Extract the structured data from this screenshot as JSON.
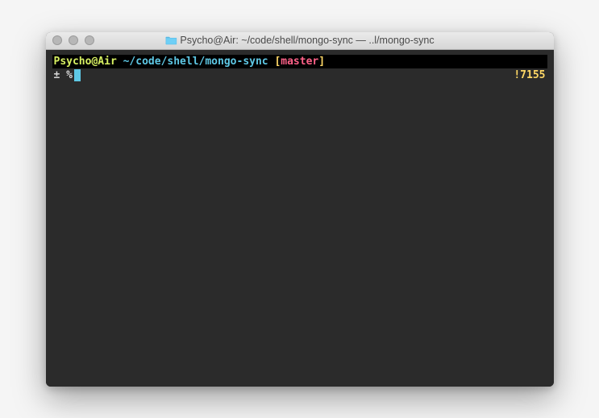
{
  "window": {
    "title": "Psycho@Air: ~/code/shell/mongo-sync — ..l/mongo-sync"
  },
  "prompt": {
    "user": "Psycho",
    "at": "@",
    "host": "Air",
    "path": "~/code/shell/mongo-sync",
    "branch_open": "[",
    "branch": "master",
    "branch_close": "]",
    "plusminus": "±",
    "percent": "%",
    "history": "!7155"
  }
}
